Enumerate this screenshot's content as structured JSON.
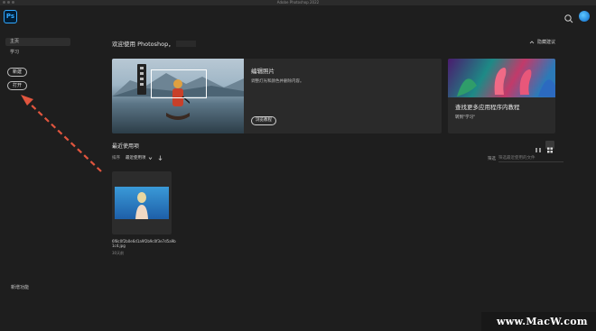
{
  "window": {
    "title": "Adobe Photoshop 2022"
  },
  "app": {
    "logo_text": "Ps"
  },
  "sidebar": {
    "items": [
      {
        "label": "主页"
      },
      {
        "label": "学习"
      }
    ],
    "new_button": "新建",
    "open_button": "打开",
    "new_features": "新增功能"
  },
  "main": {
    "welcome": "欢迎使用 Photoshop，",
    "hide_suggestions": "隐藏建议",
    "feature_card": {
      "title": "编辑照片",
      "description": "调整灯光和颜色并删除内容。",
      "button": "浏览教程"
    },
    "side_card": {
      "title": "查找更多应用程序内教程",
      "link": "转到\"学习\""
    },
    "recent": {
      "title": "最近使用项",
      "sort_label": "排序",
      "sort_value": "最近使用项",
      "filter_label": "筛选",
      "filter_placeholder": "筛选最近使用的文件",
      "files": [
        {
          "name": "6f8c0f2b0e6d1a9f2b9c0f3e7d5a9b1c4.jpg",
          "date": "30天前"
        }
      ]
    }
  },
  "watermark": {
    "text": "www.MacW.com"
  },
  "colors": {
    "accent": "#31a8ff",
    "arrow": "#e0553e",
    "background": "#1e1e1e"
  }
}
